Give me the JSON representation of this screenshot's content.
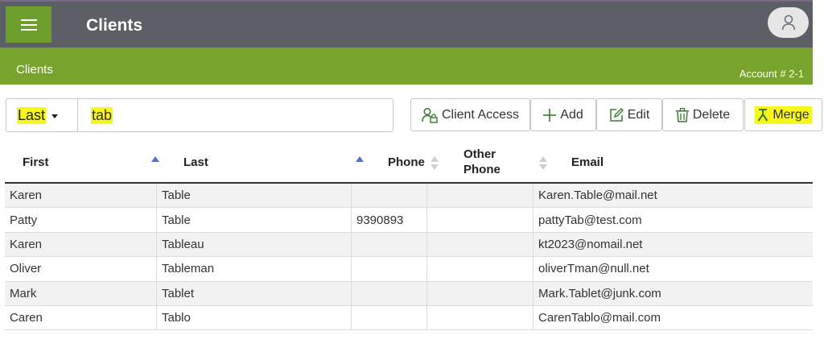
{
  "header": {
    "title": "Clients",
    "menu_icon": "hamburger-menu-icon",
    "avatar_icon": "user-icon"
  },
  "subheader": {
    "breadcrumb": "Clients",
    "account": "Account # 2-1"
  },
  "search": {
    "field": "Last",
    "query": "tab"
  },
  "toolbar": {
    "client_access": "Client Access",
    "add": "Add",
    "edit": "Edit",
    "delete": "Delete",
    "merge": "Merge"
  },
  "table": {
    "columns": {
      "first": "First",
      "last": "Last",
      "phone": "Phone",
      "other_phone_1": "Other",
      "other_phone_2": "Phone",
      "email": "Email"
    },
    "rows": [
      {
        "first": "Karen",
        "last": "Table",
        "phone": "",
        "other": "",
        "email": "Karen.Table@mail.net"
      },
      {
        "first": "Patty",
        "last": "Table",
        "phone": "9390893",
        "other": "",
        "email": "pattyTab@test.com"
      },
      {
        "first": "Karen",
        "last": "Tableau",
        "phone": "",
        "other": "",
        "email": "kt2023@nomail.net"
      },
      {
        "first": "Oliver",
        "last": "Tableman",
        "phone": "",
        "other": "",
        "email": "oliverTman@null.net"
      },
      {
        "first": "Mark",
        "last": "Tablet",
        "phone": "",
        "other": "",
        "email": "Mark.Tablet@junk.com"
      },
      {
        "first": "Caren",
        "last": "Tablo",
        "phone": "",
        "other": "",
        "email": "CarenTablo@mail.com"
      }
    ]
  },
  "colors": {
    "header_bg": "#5c5f65",
    "accent_green": "#78a42e",
    "highlight": "#f7f71a"
  }
}
